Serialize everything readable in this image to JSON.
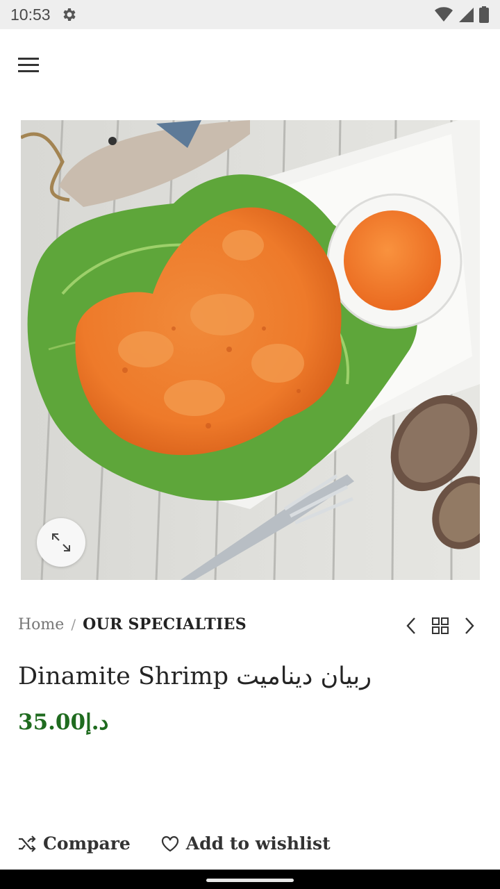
{
  "status_bar": {
    "time": "10:53"
  },
  "breadcrumb": {
    "home": "Home",
    "separator": "/",
    "current": "OUR SPECIALTIES"
  },
  "product": {
    "title": "Dinamite Shrimp ربيان ديناميت",
    "price": "35.00د.إ"
  },
  "actions": {
    "compare": "Compare",
    "wishlist": "Add to wishlist"
  },
  "colors": {
    "price": "#1f6b1f",
    "status_bar": "#eeeeee"
  }
}
